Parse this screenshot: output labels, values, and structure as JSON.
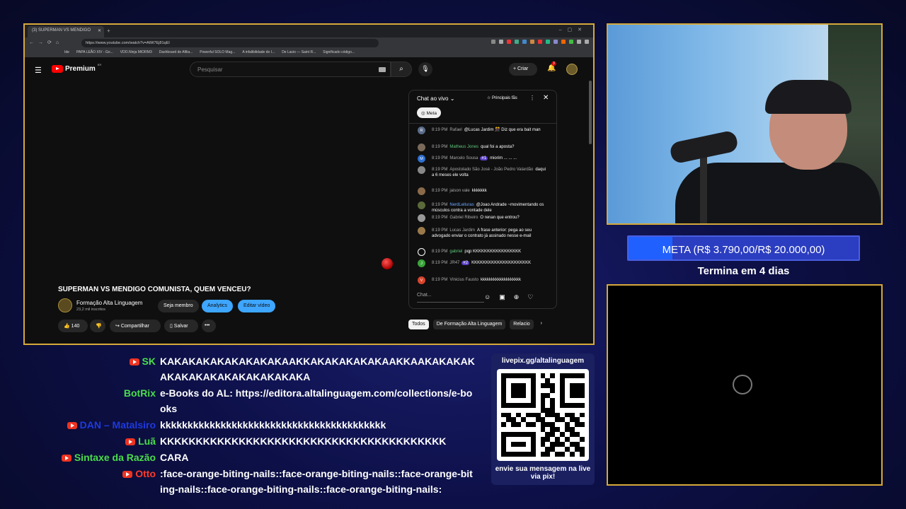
{
  "browser": {
    "tab_title": "(3) SUPERMAN VS MENDIGO",
    "url": "https://www.youtube.com/watch?v=AtW7Ej81qEI",
    "bookmarks": [
      "Ide",
      "PAPA LEÃO XIV - Go...",
      "VDO.Ninja MIORM3",
      "Dashboard de Afilia...",
      "Powerful SOLO Mag...",
      "A infalibilidade de I...",
      "De Lacio — Saint R...",
      "Significado código..."
    ]
  },
  "youtube": {
    "logo": "Premium",
    "logo_region": "BR",
    "search_placeholder": "Pesquisar",
    "create_label": "Criar",
    "notif_count": "3",
    "video_title": "SUPERMAN VS MENDIGO COMUNISTA, QUEM VENCEU?",
    "channel_name": "Formação Alta Linguagem",
    "channel_subs": "23,2 mil inscritos",
    "member_label": "Seja membro",
    "analytics_label": "Analytics",
    "edit_label": "Editar vídeo",
    "likes": "140",
    "share_label": "Compartilhar",
    "save_label": "Salvar",
    "more_label": "•••",
    "chips": [
      "Todos",
      "De Formação Alta Linguagem",
      "Relacio"
    ]
  },
  "chat": {
    "title": "Chat ao vivo",
    "top_fans": "Principais fãs",
    "meta_chip": "Meta",
    "input_placeholder": "Chat...",
    "messages": [
      {
        "time": "8:19 PM",
        "author": "Rafael",
        "text": "@Lucas Jardim 🎊 Diz que era bait man",
        "color": "#5a6c8a",
        "initial": "R",
        "style": "n"
      },
      {
        "time": "8:19 PM",
        "author": "Matheus Jones",
        "text": "qual foi a aposta?",
        "color": "#7a6a5a",
        "initial": "",
        "style": "n g"
      },
      {
        "time": "8:19 PM",
        "author": "Marcelo Sousa",
        "badge": "#1",
        "text": "miorim ... ... ...",
        "color": "#2d6fd1",
        "initial": "M",
        "style": "n"
      },
      {
        "time": "8:19 PM",
        "author": "Apostolado São José - João Pedro Valardão",
        "text": "daqui a 6 meses ele volta",
        "color": "#888",
        "initial": "",
        "style": "n"
      },
      {
        "time": "8:19 PM",
        "author": "jaison vale",
        "text": "kkkkkkk",
        "color": "#8a6a4a",
        "initial": "",
        "style": "n"
      },
      {
        "time": "8:19 PM",
        "author": "NerdLeituras",
        "text": "@Joao Andrade ~movimentando os músculos contra a vontade dele",
        "color": "#5a6a3a",
        "initial": "",
        "style": "n b"
      },
      {
        "time": "8:19 PM",
        "author": "Gabriel Ribeiro",
        "text": "O renan que entrou?",
        "color": "#999",
        "initial": "",
        "style": "n"
      },
      {
        "time": "8:19 PM",
        "author": "Lucas Jardim",
        "text": "A frase anterior: pega ao seu advogado enviar o contrato já assinado nesse e-mail",
        "color": "#9a7a4a",
        "initial": "",
        "style": "n"
      },
      {
        "time": "8:19 PM",
        "author": "gabriel",
        "text": "pqp KKKKKKKKKKKKKKKKK",
        "color": "#111",
        "initial": "",
        "style": "n g"
      },
      {
        "time": "8:19 PM",
        "author": "JR47",
        "badge": "#2",
        "text": "KKKKKKKKKKKKKKKKKKKKK",
        "color": "#3aa43a",
        "initial": "J",
        "style": "n"
      },
      {
        "time": "8:19 PM",
        "author": "Vinicius Fausto",
        "text": "kkkkkkkkkkkkkkkkkkk",
        "color": "#d9432b",
        "initial": "V",
        "style": "n"
      }
    ]
  },
  "goal": {
    "label": "META (R$ 3.790,00/R$ 20.000,00)",
    "progress": 0.19,
    "subtitle": "Termina em 4 dias"
  },
  "overlay_chat": [
    {
      "name": "SK",
      "name_color": "#4ade4a",
      "text": "KAKAKAKAKAKAKAKAKAAKKAKAKAKAKAKAAKKAAKAKAKAKAKAKAKAKAKAKAKAKAKAKA",
      "lines": 2
    },
    {
      "name": "BotRix",
      "name_color": "#4ade4a",
      "text": "e-Books do AL: https://editora.altalinguagem.com/collections/e-books",
      "lines": 2
    },
    {
      "name": "DAN – Matalsiro",
      "name_color": "#1e3adf",
      "text": "kkkkkkkkkkkkkkkkkkkkkkkkkkkkkkkkkkkkkkkkk",
      "lines": 1
    },
    {
      "name": "Luã",
      "name_color": "#4ade4a",
      "text": "KKKKKKKKKKKKKKKKKKKKKKKKKKKKKKKKKKKKKKKK",
      "lines": 1
    },
    {
      "name": "Sintaxe da Razão",
      "name_color": "#4ade4a",
      "text": "CARA",
      "lines": 1
    },
    {
      "name": "Otto",
      "name_color": "#ff3a2a",
      "text": ":face-orange-biting-nails::face-orange-biting-nails::face-orange-biting-nails::face-orange-biting-nails::face-orange-biting-nails:",
      "lines": 2
    }
  ],
  "qr": {
    "top": "livepix.gg/altalinguagem",
    "bottom": "envie sua mensagem na live via pix!"
  }
}
